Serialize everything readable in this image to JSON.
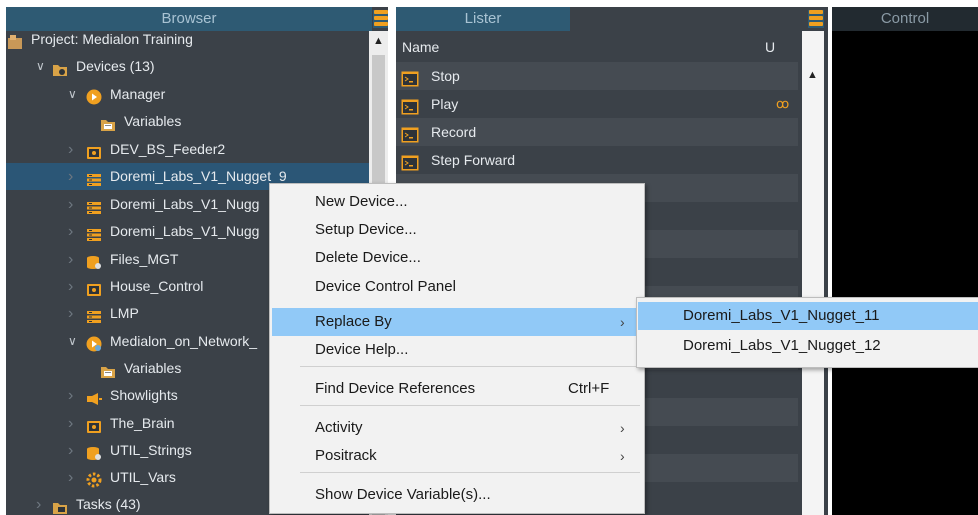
{
  "panes": {
    "browser_title": "Browser",
    "lister_title": "Lister",
    "control_title": "Control"
  },
  "browser_tree": [
    {
      "label": "Project: Medialon Training",
      "icon": "project-icon",
      "chevron": ""
    },
    {
      "label": "Devices (13)",
      "icon": "devices-folder-icon",
      "chevron": "down"
    },
    {
      "label": "Manager",
      "icon": "manager-icon",
      "chevron": "down"
    },
    {
      "label": "Variables",
      "icon": "variables-icon",
      "chevron": ""
    },
    {
      "label": "DEV_BS_Feeder2",
      "icon": "device-icon",
      "chevron": "right"
    },
    {
      "label": "Doremi_Labs_V1_Nugget_9",
      "icon": "doremi-icon",
      "chevron": "right"
    },
    {
      "label": "Doremi_Labs_V1_Nugg",
      "icon": "doremi-icon",
      "chevron": "right"
    },
    {
      "label": "Doremi_Labs_V1_Nugg",
      "icon": "doremi-icon",
      "chevron": "right"
    },
    {
      "label": "Files_MGT",
      "icon": "files-icon",
      "chevron": "right"
    },
    {
      "label": "House_Control",
      "icon": "device-icon",
      "chevron": "right"
    },
    {
      "label": "LMP",
      "icon": "doremi-icon",
      "chevron": "right"
    },
    {
      "label": "Medialon_on_Network_",
      "icon": "network-icon",
      "chevron": "down"
    },
    {
      "label": "Variables",
      "icon": "variables-icon",
      "chevron": ""
    },
    {
      "label": "Showlights",
      "icon": "showlights-icon",
      "chevron": "right"
    },
    {
      "label": "The_Brain",
      "icon": "device-icon",
      "chevron": "right"
    },
    {
      "label": "UTIL_Strings",
      "icon": "files-icon",
      "chevron": "right"
    },
    {
      "label": "UTIL_Vars",
      "icon": "gear-icon",
      "chevron": "right"
    },
    {
      "label": "Tasks (43)",
      "icon": "tasks-folder-icon",
      "chevron": "right"
    }
  ],
  "lister": {
    "col_name": "Name",
    "col_u": "U",
    "rows": [
      "Stop",
      "Play",
      "Record",
      "Step Forward"
    ]
  },
  "context_menu": {
    "items": [
      {
        "label": "New Device..."
      },
      {
        "label": "Setup Device..."
      },
      {
        "label": "Delete Device..."
      },
      {
        "label": "Device Control Panel"
      },
      {
        "label": "Replace By",
        "submenu": true
      },
      {
        "label": "Device Help..."
      },
      {
        "label": "Find Device References",
        "shortcut": "Ctrl+F"
      },
      {
        "label": "Activity",
        "submenu": true
      },
      {
        "label": "Positrack",
        "submenu": true
      },
      {
        "label": "Show Device Variable(s)..."
      }
    ],
    "arrow": "›"
  },
  "submenu": {
    "items": [
      "Doremi_Labs_V1_Nugget_11",
      "Doremi_Labs_V1_Nugget_12"
    ]
  },
  "colors": {
    "header_bg": "#2e5a73",
    "pane_bg": "#3b4148",
    "selection": "#2b5676",
    "menu_hover": "#91c9f7",
    "accent_orange": "#f0a020"
  }
}
